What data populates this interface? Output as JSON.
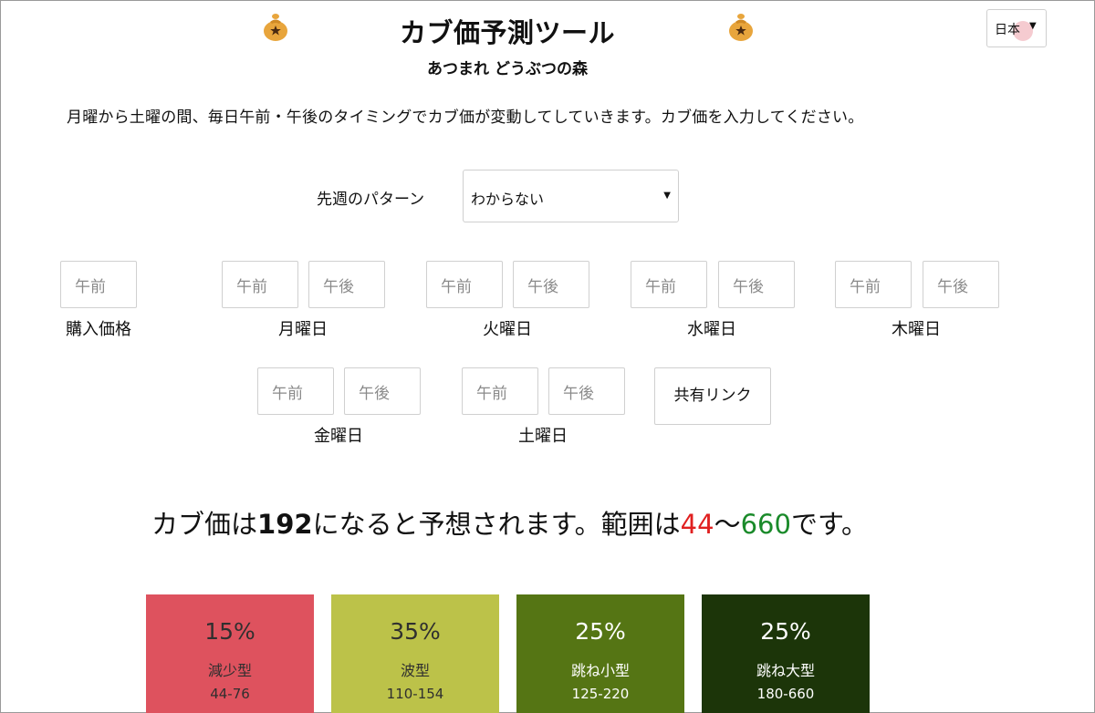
{
  "header": {
    "title": "カブ価予測ツール",
    "subtitle": "あつまれ どうぶつの森"
  },
  "language": {
    "selected": "日本"
  },
  "description": "月曜から土曜の間、毎日午前・午後のタイミングでカブ価が変動してしていきます。カブ価を入力してください。",
  "pattern": {
    "label": "先週のパターン",
    "selected": "わからない"
  },
  "purchase": {
    "placeholder": "午前",
    "label": "購入価格"
  },
  "days": [
    {
      "label": "月曜日",
      "am": "午前",
      "pm": "午後"
    },
    {
      "label": "火曜日",
      "am": "午前",
      "pm": "午後"
    },
    {
      "label": "水曜日",
      "am": "午前",
      "pm": "午後"
    },
    {
      "label": "木曜日",
      "am": "午前",
      "pm": "午後"
    },
    {
      "label": "金曜日",
      "am": "午前",
      "pm": "午後"
    },
    {
      "label": "土曜日",
      "am": "午前",
      "pm": "午後"
    }
  ],
  "share_button": "共有リンク",
  "forecast": {
    "prefix": "カブ価は",
    "predicted": "192",
    "middle": "になると予想されます。範囲は",
    "min": "44",
    "sep": "～",
    "max": "660",
    "suffix": "です。"
  },
  "patterns": [
    {
      "percent": "15%",
      "name": "減少型",
      "range": "44-76",
      "color": "#de525e"
    },
    {
      "percent": "35%",
      "name": "波型",
      "range": "110-154",
      "color": "#bcc249"
    },
    {
      "percent": "25%",
      "name": "跳ね小型",
      "range": "125-220",
      "color": "#557514"
    },
    {
      "percent": "25%",
      "name": "跳ね大型",
      "range": "180-660",
      "color": "#1c3509"
    }
  ],
  "icons": {
    "title_decoration": "turnip-money-bag-icon",
    "dropdown": "caret-down-icon"
  }
}
